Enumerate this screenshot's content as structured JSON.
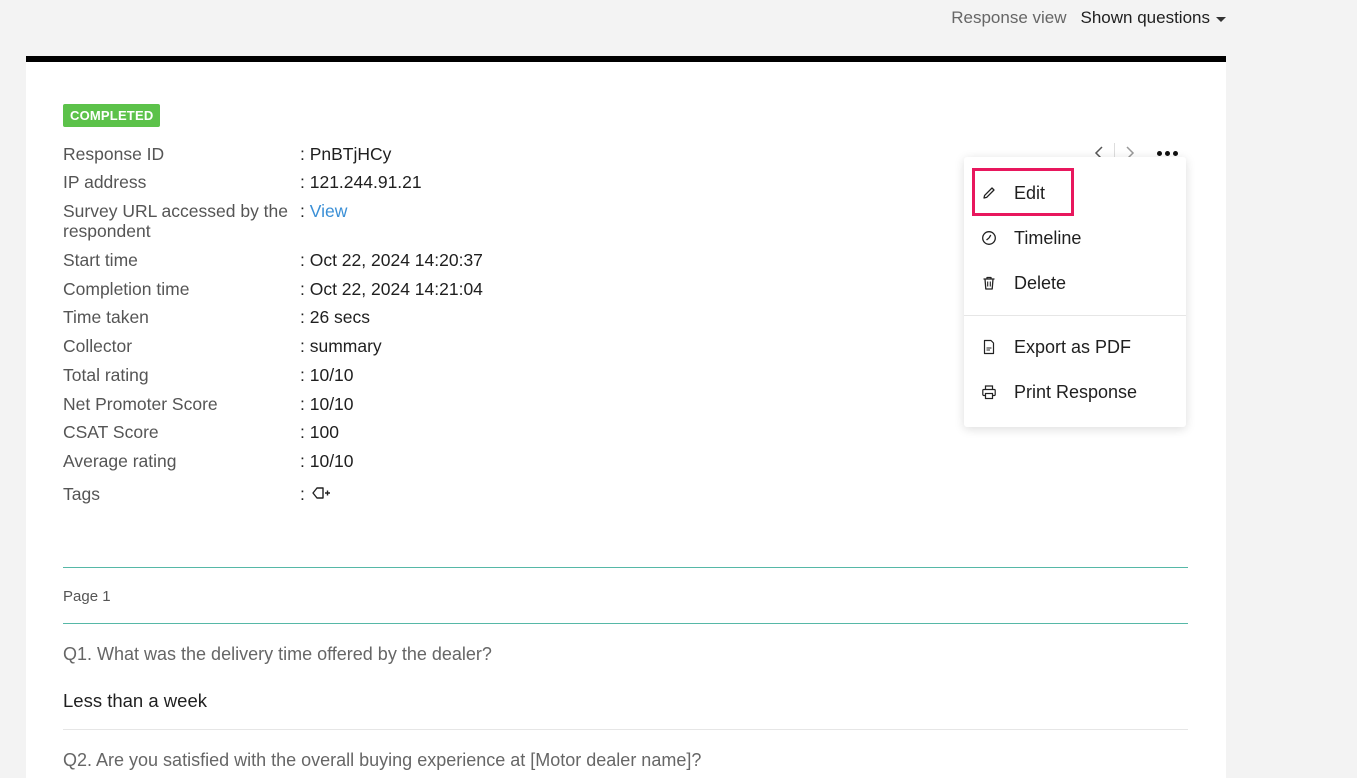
{
  "top_bar": {
    "response_view": "Response view",
    "shown_questions": "Shown questions"
  },
  "status": "COMPLETED",
  "meta": [
    {
      "key": "Response ID",
      "value": ": PnBTjHCy"
    },
    {
      "key": "IP address",
      "value": ": 121.244.91.21"
    },
    {
      "key": "Survey URL accessed by the respondent",
      "value": ":",
      "link": "View"
    },
    {
      "key": "Start time",
      "value": ": Oct 22, 2024 14:20:37"
    },
    {
      "key": "Completion time",
      "value": ": Oct 22, 2024 14:21:04"
    },
    {
      "key": "Time taken",
      "value": ": 26 secs"
    },
    {
      "key": "Collector",
      "value": ": summary"
    },
    {
      "key": "Total rating",
      "value": ": 10/10"
    },
    {
      "key": "Net Promoter Score",
      "value": ": 10/10"
    },
    {
      "key": "CSAT Score",
      "value": ": 100"
    },
    {
      "key": "Average rating",
      "value": ": 10/10"
    },
    {
      "key": "Tags",
      "value": ":"
    }
  ],
  "menu": {
    "items": [
      {
        "label": "Edit",
        "icon": "pencil-icon"
      },
      {
        "label": "Timeline",
        "icon": "clock-icon"
      },
      {
        "label": "Delete",
        "icon": "trash-icon"
      },
      {
        "label": "Export as PDF",
        "icon": "pdf-file-icon"
      },
      {
        "label": "Print Response",
        "icon": "printer-icon"
      }
    ]
  },
  "page_label": "Page 1",
  "questions": [
    {
      "q": "Q1. What was the delivery time offered by the dealer?",
      "a": "Less than a week"
    },
    {
      "q": "Q2. Are you satisfied with the overall buying experience at [Motor dealer name]?",
      "a": ""
    }
  ],
  "colors": {
    "badge": "#5cc24a",
    "link": "#3a8fd6",
    "highlight": "#e8175d",
    "divider": "#56b8a7"
  }
}
